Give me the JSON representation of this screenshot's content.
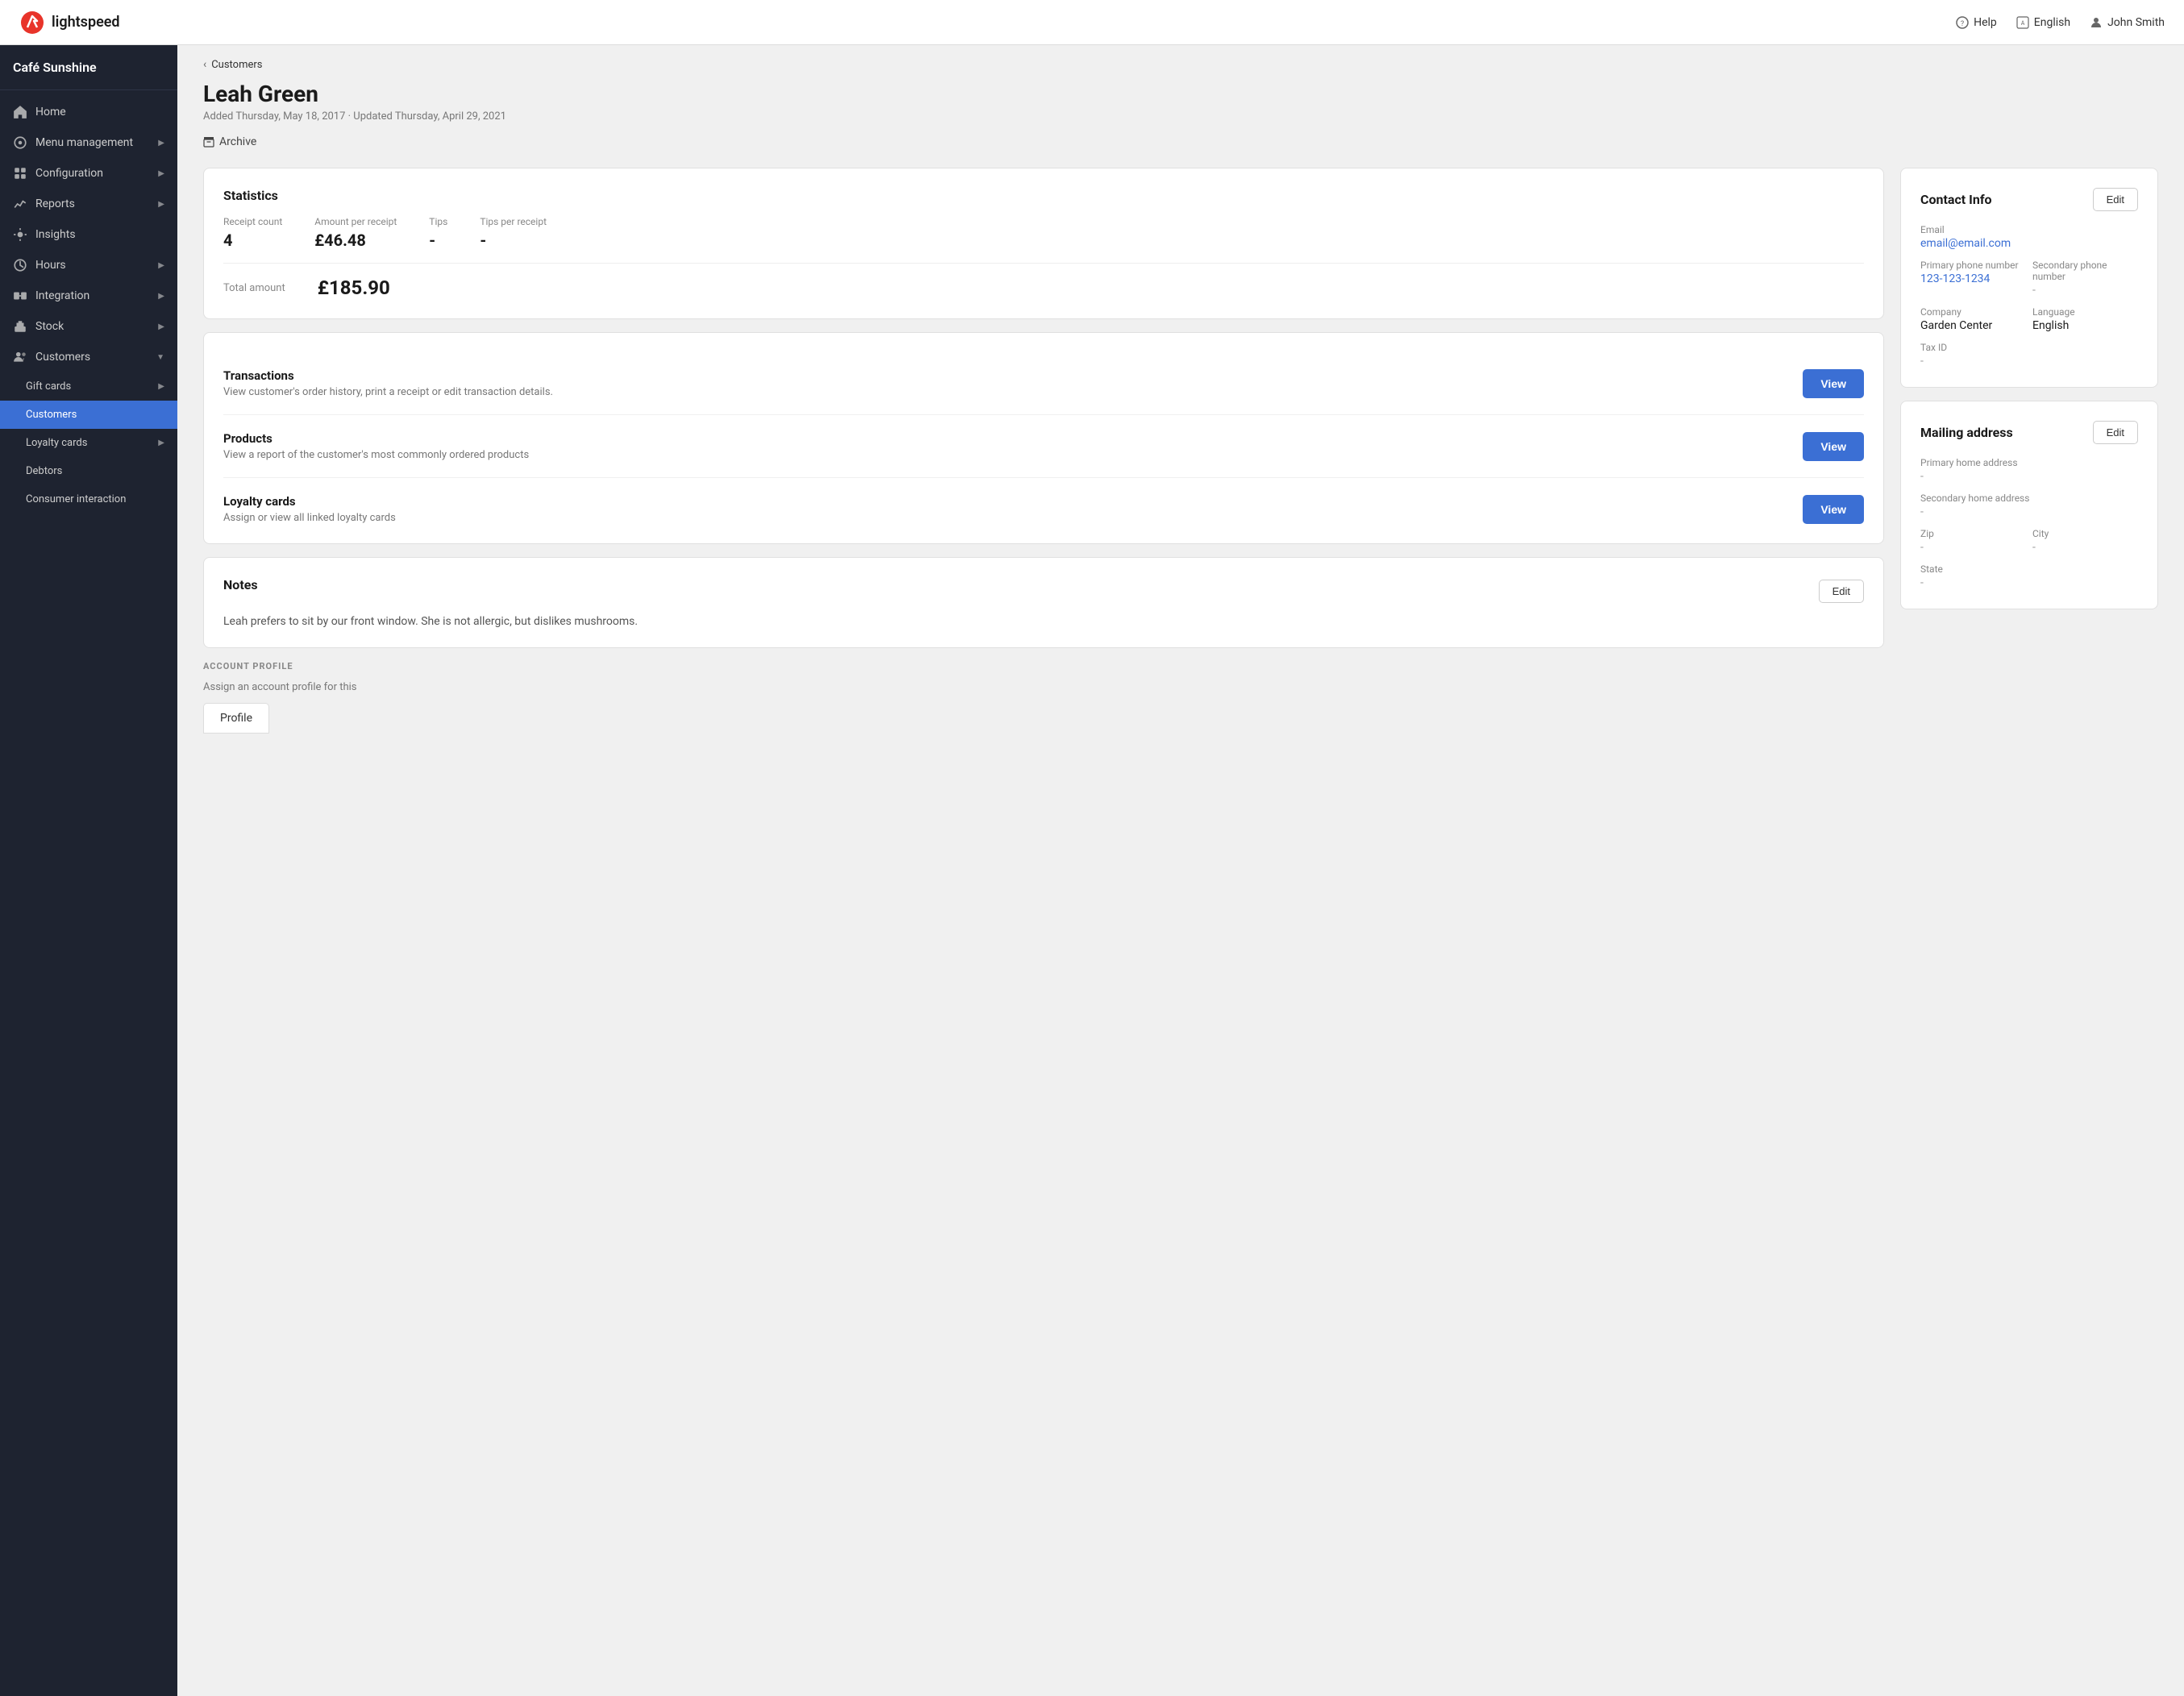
{
  "topbar": {
    "logo_text": "lightspeed",
    "help_label": "Help",
    "language_label": "English",
    "user_label": "John Smith"
  },
  "sidebar": {
    "brand": "Café Sunshine",
    "items": [
      {
        "id": "home",
        "label": "Home",
        "icon": "home",
        "level": 0
      },
      {
        "id": "menu-management",
        "label": "Menu management",
        "icon": "menu",
        "level": 0,
        "has_arrow": true
      },
      {
        "id": "configuration",
        "label": "Configuration",
        "icon": "config",
        "level": 0,
        "has_arrow": true
      },
      {
        "id": "reports",
        "label": "Reports",
        "icon": "reports",
        "level": 0,
        "has_arrow": true
      },
      {
        "id": "insights",
        "label": "Insights",
        "icon": "insights",
        "level": 0
      },
      {
        "id": "hours",
        "label": "Hours",
        "icon": "hours",
        "level": 0,
        "has_arrow": true
      },
      {
        "id": "integration",
        "label": "Integration",
        "icon": "integration",
        "level": 0,
        "has_arrow": true
      },
      {
        "id": "stock",
        "label": "Stock",
        "icon": "stock",
        "level": 0,
        "has_arrow": true
      },
      {
        "id": "customers",
        "label": "Customers",
        "icon": "customers",
        "level": 0,
        "has_arrow": true,
        "expanded": true
      },
      {
        "id": "gift-cards",
        "label": "Gift cards",
        "icon": "",
        "level": 1,
        "has_arrow": true
      },
      {
        "id": "customers-sub",
        "label": "Customers",
        "icon": "",
        "level": 1,
        "active": true
      },
      {
        "id": "loyalty-cards",
        "label": "Loyalty cards",
        "icon": "",
        "level": 1,
        "has_arrow": true
      },
      {
        "id": "debtors",
        "label": "Debtors",
        "icon": "",
        "level": 1
      },
      {
        "id": "consumer-interaction",
        "label": "Consumer interaction",
        "icon": "",
        "level": 1
      }
    ]
  },
  "breadcrumb": {
    "text": "Customers"
  },
  "customer": {
    "name": "Leah Green",
    "added_date": "Added Thursday, May 18, 2017 · Updated Thursday, April 29, 2021",
    "archive_label": "Archive"
  },
  "statistics": {
    "title": "Statistics",
    "receipt_count_label": "Receipt count",
    "receipt_count_value": "4",
    "amount_per_receipt_label": "Amount per receipt",
    "amount_per_receipt_value": "£46.48",
    "tips_label": "Tips",
    "tips_value": "-",
    "tips_per_receipt_label": "Tips per receipt",
    "tips_per_receipt_value": "-",
    "total_amount_label": "Total amount",
    "total_amount_value": "£185.90"
  },
  "transactions": {
    "title": "Transactions",
    "description": "View customer's order history, print a receipt or edit transaction details.",
    "button_label": "View"
  },
  "products": {
    "title": "Products",
    "description": "View a report of the customer's most commonly ordered products",
    "button_label": "View"
  },
  "loyalty_cards": {
    "title": "Loyalty cards",
    "description": "Assign or view all linked loyalty cards",
    "button_label": "View"
  },
  "notes": {
    "title": "Notes",
    "edit_label": "Edit",
    "text": "Leah prefers to sit by our front window. She is not allergic, but dislikes mushrooms."
  },
  "contact_info": {
    "title": "Contact Info",
    "edit_label": "Edit",
    "email_label": "Email",
    "email_value": "email@email.com",
    "primary_phone_label": "Primary phone number",
    "primary_phone_value": "123-123-1234",
    "secondary_phone_label": "Secondary phone number",
    "secondary_phone_value": "-",
    "company_label": "Company",
    "company_value": "Garden Center",
    "language_label": "Language",
    "language_value": "English",
    "tax_id_label": "Tax ID",
    "tax_id_value": "-"
  },
  "mailing_address": {
    "title": "Mailing address",
    "edit_label": "Edit",
    "primary_home_label": "Primary home address",
    "primary_home_value": "-",
    "secondary_home_label": "Secondary home address",
    "secondary_home_value": "-",
    "zip_label": "Zip",
    "zip_value": "-",
    "city_label": "City",
    "city_value": "-",
    "state_label": "State",
    "state_value": "-"
  },
  "account_profile": {
    "section_label": "ACCOUNT PROFILE",
    "description": "Assign an account profile for this",
    "tab_label": "Profile"
  }
}
